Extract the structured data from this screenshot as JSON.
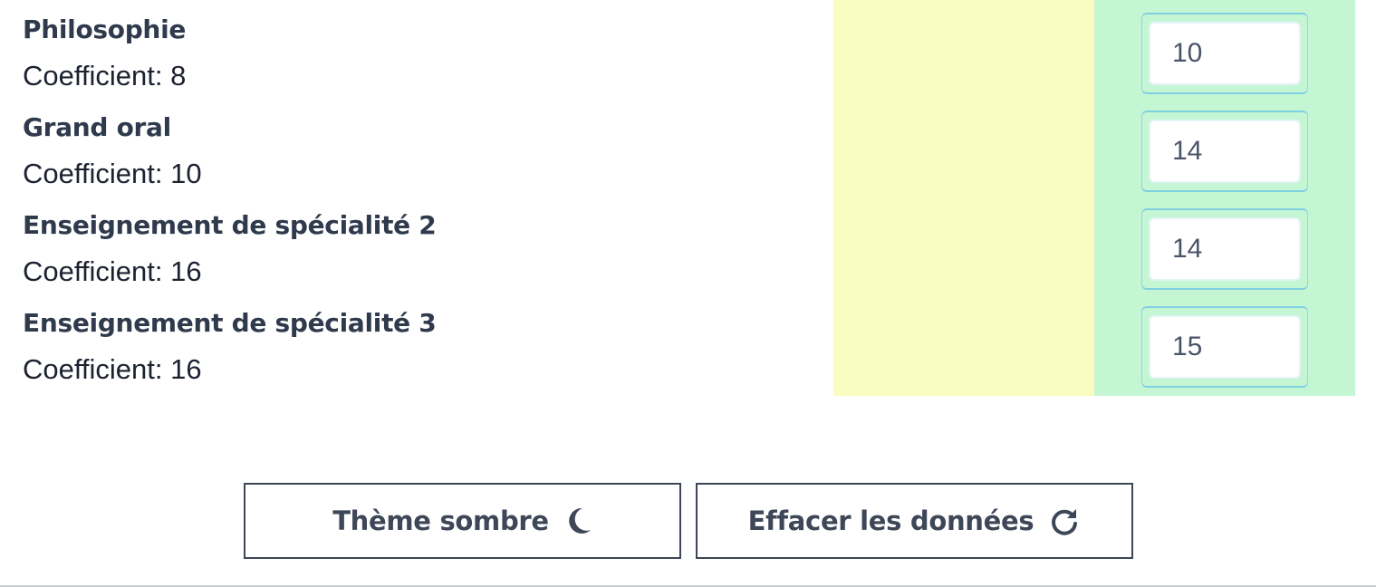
{
  "subjects": [
    {
      "name": "Philosophie",
      "coefficient": "Coefficient: 8",
      "grade": "10"
    },
    {
      "name": "Grand oral",
      "coefficient": "Coefficient: 10",
      "grade": "14"
    },
    {
      "name": "Enseignement de spécialité 2",
      "coefficient": "Coefficient: 16",
      "grade": "14"
    },
    {
      "name": "Enseignement de spécialité 3",
      "coefficient": "Coefficient: 16",
      "grade": "15"
    }
  ],
  "actions": {
    "theme_label": "Thème sombre",
    "theme_icon": "moon-icon",
    "reset_label": "Effacer les données",
    "reset_icon": "refresh-icon"
  },
  "colors": {
    "column_yellow": "#fafcc2",
    "column_green": "#c5f6d4",
    "input_border": "#7fd0de",
    "button_text": "#3d4758"
  }
}
